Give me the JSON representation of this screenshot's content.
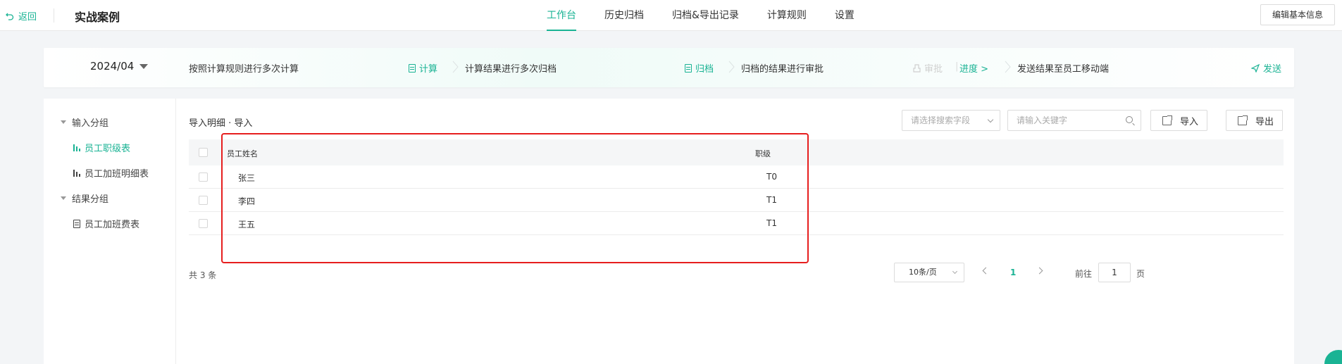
{
  "topbar": {
    "back_label": "返回",
    "title": "实战案例",
    "tabs": [
      {
        "label": "工作台",
        "active": true
      },
      {
        "label": "历史归档",
        "active": false
      },
      {
        "label": "归档&导出记录",
        "active": false
      },
      {
        "label": "计算规则",
        "active": false
      },
      {
        "label": "设置",
        "active": false
      }
    ],
    "edit_button": "编辑基本信息"
  },
  "stepbar": {
    "month": "2024/04",
    "step1_desc": "按照计算规则进行多次计算",
    "step1_action": "计算",
    "step2_desc": "计算结果进行多次归档",
    "step2_action": "归档",
    "step3_desc": "归档的结果进行审批",
    "step3_action": "审批",
    "step3_progress": "进度 >",
    "step4_desc": "发送结果至员工移动端",
    "step4_action": "发送"
  },
  "sidenav": {
    "group1": "输入分组",
    "group1_items": [
      "员工职级表",
      "员工加班明细表"
    ],
    "group2": "结果分组",
    "group2_items": [
      "员工加班费表"
    ],
    "active_item": "员工职级表"
  },
  "content": {
    "section_title": "导入明细 · 导入",
    "search_field_placeholder": "请选择搜索字段",
    "search_placeholder": "请输入关键字",
    "import_label": "导入",
    "export_label": "导出",
    "columns": [
      "员工姓名",
      "职级"
    ],
    "rows": [
      {
        "name": "张三",
        "level": "T0"
      },
      {
        "name": "李四",
        "level": "T1"
      },
      {
        "name": "王五",
        "level": "T1"
      }
    ],
    "total": "共 3 条",
    "page_size": "10条/页",
    "current_page": "1",
    "goto_label": "前往",
    "goto_value": "1",
    "goto_suffix": "页"
  },
  "colors": {
    "accent": "#1ab394",
    "highlight": "#e61e1e"
  }
}
